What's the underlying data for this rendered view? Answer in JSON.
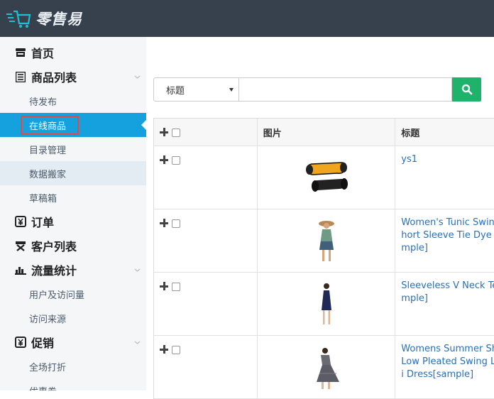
{
  "app": {
    "logo_text": "零售易",
    "brand_color": "#37414d",
    "accent_color": "#15a0de"
  },
  "sidebar": {
    "items": [
      {
        "label": "首页",
        "level": "top",
        "icon": "store-icon",
        "caret": false
      },
      {
        "label": "商品列表",
        "level": "top",
        "icon": "list-icon",
        "caret": true
      },
      {
        "label": "待发布",
        "level": "sub"
      },
      {
        "label": "在线商品",
        "level": "sub",
        "active": true
      },
      {
        "label": "目录管理",
        "level": "sub"
      },
      {
        "label": "数据搬家",
        "level": "sub",
        "hover": true
      },
      {
        "label": "草稿箱",
        "level": "sub"
      },
      {
        "label": "订单",
        "level": "top",
        "icon": "order-icon",
        "caret": false
      },
      {
        "label": "客户列表",
        "level": "top",
        "icon": "customer-icon",
        "caret": false
      },
      {
        "label": "流量统计",
        "level": "top",
        "icon": "chart-icon",
        "caret": true
      },
      {
        "label": "用户及访问量",
        "level": "sub"
      },
      {
        "label": "访问来源",
        "level": "sub"
      },
      {
        "label": "促销",
        "level": "top",
        "icon": "promo-icon",
        "caret": true
      },
      {
        "label": "全场打折",
        "level": "sub"
      },
      {
        "label": "优惠券",
        "level": "sub"
      }
    ]
  },
  "search": {
    "field_selected": "标题",
    "query": "",
    "button_icon": "search-icon"
  },
  "table": {
    "columns": [
      "",
      "图片",
      "标题"
    ],
    "rows": [
      {
        "image": "hoverboard",
        "title": "ys1"
      },
      {
        "image": "tunic-dress",
        "title": "Women's Tunic Swing\nhort Sleeve Tie Dye C\nmple]"
      },
      {
        "image": "sleeveless-dress",
        "title": "Sleeveless V Neck Te\nmple]"
      },
      {
        "image": "summer-dress",
        "title": "Womens Summer Sh\nLow Pleated Swing Lo\ni Dress[sample]"
      }
    ]
  }
}
